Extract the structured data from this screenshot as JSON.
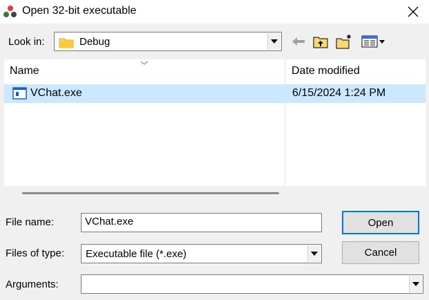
{
  "window": {
    "title": "Open 32-bit executable",
    "close_icon": "close-icon"
  },
  "look_in": {
    "label": "Look in:",
    "value": "Debug",
    "icons": [
      "back-arrow-icon",
      "up-folder-icon",
      "new-folder-icon",
      "view-menu-icon"
    ]
  },
  "file_list": {
    "columns": [
      "Name",
      "Date modified"
    ],
    "rows": [
      {
        "name": "VChat.exe",
        "date_modified": "6/15/2024 1:24 PM",
        "selected": true
      }
    ]
  },
  "form": {
    "file_name_label": "File name:",
    "file_name_value": "VChat.exe",
    "files_of_type_label": "Files of type:",
    "files_of_type_value": "Executable file (*.exe)",
    "arguments_label": "Arguments:",
    "arguments_value": ""
  },
  "buttons": {
    "open": "Open",
    "cancel": "Cancel"
  },
  "colors": {
    "selection": "#cce8ff",
    "default_button_border": "#0078d7"
  }
}
